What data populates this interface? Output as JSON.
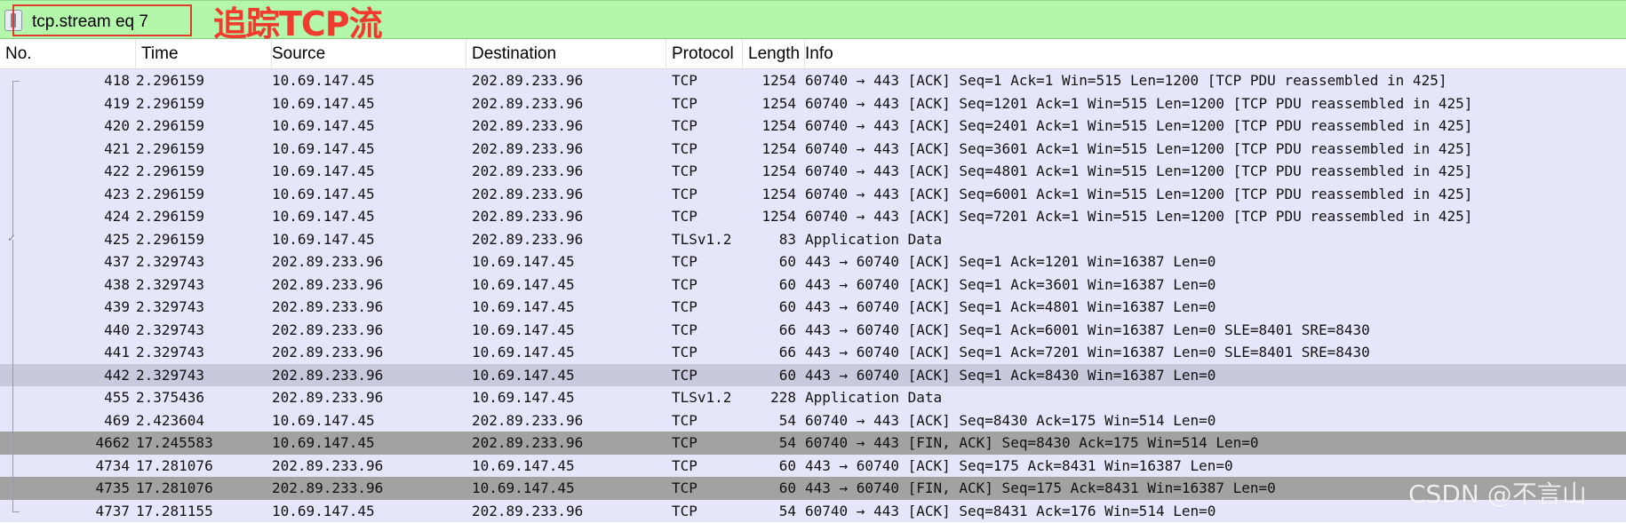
{
  "filter": {
    "value": "tcp.stream eq 7",
    "annotation": "追踪TCP流"
  },
  "columns": {
    "no": "No.",
    "time": "Time",
    "source": "Source",
    "destination": "Destination",
    "protocol": "Protocol",
    "length": "Length",
    "info": "Info"
  },
  "packets": [
    {
      "no": "418",
      "time": "2.296159",
      "src": "10.69.147.45",
      "dst": "202.89.233.96",
      "proto": "TCP",
      "len": "1254",
      "info": "60740 → 443 [ACK] Seq=1 Ack=1 Win=515 Len=1200 [TCP PDU reassembled in 425]",
      "style": "normal"
    },
    {
      "no": "419",
      "time": "2.296159",
      "src": "10.69.147.45",
      "dst": "202.89.233.96",
      "proto": "TCP",
      "len": "1254",
      "info": "60740 → 443 [ACK] Seq=1201 Ack=1 Win=515 Len=1200 [TCP PDU reassembled in 425]",
      "style": "normal"
    },
    {
      "no": "420",
      "time": "2.296159",
      "src": "10.69.147.45",
      "dst": "202.89.233.96",
      "proto": "TCP",
      "len": "1254",
      "info": "60740 → 443 [ACK] Seq=2401 Ack=1 Win=515 Len=1200 [TCP PDU reassembled in 425]",
      "style": "normal"
    },
    {
      "no": "421",
      "time": "2.296159",
      "src": "10.69.147.45",
      "dst": "202.89.233.96",
      "proto": "TCP",
      "len": "1254",
      "info": "60740 → 443 [ACK] Seq=3601 Ack=1 Win=515 Len=1200 [TCP PDU reassembled in 425]",
      "style": "normal"
    },
    {
      "no": "422",
      "time": "2.296159",
      "src": "10.69.147.45",
      "dst": "202.89.233.96",
      "proto": "TCP",
      "len": "1254",
      "info": "60740 → 443 [ACK] Seq=4801 Ack=1 Win=515 Len=1200 [TCP PDU reassembled in 425]",
      "style": "normal"
    },
    {
      "no": "423",
      "time": "2.296159",
      "src": "10.69.147.45",
      "dst": "202.89.233.96",
      "proto": "TCP",
      "len": "1254",
      "info": "60740 → 443 [ACK] Seq=6001 Ack=1 Win=515 Len=1200 [TCP PDU reassembled in 425]",
      "style": "normal"
    },
    {
      "no": "424",
      "time": "2.296159",
      "src": "10.69.147.45",
      "dst": "202.89.233.96",
      "proto": "TCP",
      "len": "1254",
      "info": "60740 → 443 [ACK] Seq=7201 Ack=1 Win=515 Len=1200 [TCP PDU reassembled in 425]",
      "style": "normal"
    },
    {
      "no": "425",
      "time": "2.296159",
      "src": "10.69.147.45",
      "dst": "202.89.233.96",
      "proto": "TLSv1.2",
      "len": "83",
      "info": "Application Data",
      "style": "normal"
    },
    {
      "no": "437",
      "time": "2.329743",
      "src": "202.89.233.96",
      "dst": "10.69.147.45",
      "proto": "TCP",
      "len": "60",
      "info": "443 → 60740 [ACK] Seq=1 Ack=1201 Win=16387 Len=0",
      "style": "normal"
    },
    {
      "no": "438",
      "time": "2.329743",
      "src": "202.89.233.96",
      "dst": "10.69.147.45",
      "proto": "TCP",
      "len": "60",
      "info": "443 → 60740 [ACK] Seq=1 Ack=3601 Win=16387 Len=0",
      "style": "normal"
    },
    {
      "no": "439",
      "time": "2.329743",
      "src": "202.89.233.96",
      "dst": "10.69.147.45",
      "proto": "TCP",
      "len": "60",
      "info": "443 → 60740 [ACK] Seq=1 Ack=4801 Win=16387 Len=0",
      "style": "normal"
    },
    {
      "no": "440",
      "time": "2.329743",
      "src": "202.89.233.96",
      "dst": "10.69.147.45",
      "proto": "TCP",
      "len": "66",
      "info": "443 → 60740 [ACK] Seq=1 Ack=6001 Win=16387 Len=0 SLE=8401 SRE=8430",
      "style": "normal"
    },
    {
      "no": "441",
      "time": "2.329743",
      "src": "202.89.233.96",
      "dst": "10.69.147.45",
      "proto": "TCP",
      "len": "66",
      "info": "443 → 60740 [ACK] Seq=1 Ack=7201 Win=16387 Len=0 SLE=8401 SRE=8430",
      "style": "normal"
    },
    {
      "no": "442",
      "time": "2.329743",
      "src": "202.89.233.96",
      "dst": "10.69.147.45",
      "proto": "TCP",
      "len": "60",
      "info": "443 → 60740 [ACK] Seq=1 Ack=8430 Win=16387 Len=0",
      "style": "selected"
    },
    {
      "no": "455",
      "time": "2.375436",
      "src": "202.89.233.96",
      "dst": "10.69.147.45",
      "proto": "TLSv1.2",
      "len": "228",
      "info": "Application Data",
      "style": "normal"
    },
    {
      "no": "469",
      "time": "2.423604",
      "src": "10.69.147.45",
      "dst": "202.89.233.96",
      "proto": "TCP",
      "len": "54",
      "info": "60740 → 443 [ACK] Seq=8430 Ack=175 Win=514 Len=0",
      "style": "normal"
    },
    {
      "no": "4662",
      "time": "17.245583",
      "src": "10.69.147.45",
      "dst": "202.89.233.96",
      "proto": "TCP",
      "len": "54",
      "info": "60740 → 443 [FIN, ACK] Seq=8430 Ack=175 Win=514 Len=0",
      "style": "dark"
    },
    {
      "no": "4734",
      "time": "17.281076",
      "src": "202.89.233.96",
      "dst": "10.69.147.45",
      "proto": "TCP",
      "len": "60",
      "info": "443 → 60740 [ACK] Seq=175 Ack=8431 Win=16387 Len=0",
      "style": "normal"
    },
    {
      "no": "4735",
      "time": "17.281076",
      "src": "202.89.233.96",
      "dst": "10.69.147.45",
      "proto": "TCP",
      "len": "60",
      "info": "443 → 60740 [FIN, ACK] Seq=175 Ack=8431 Win=16387 Len=0",
      "style": "dark"
    },
    {
      "no": "4737",
      "time": "17.281155",
      "src": "10.69.147.45",
      "dst": "202.89.233.96",
      "proto": "TCP",
      "len": "54",
      "info": "60740 → 443 [ACK] Seq=8431 Ack=176 Win=514 Len=0",
      "style": "normal"
    }
  ],
  "watermark": "CSDN @不言山",
  "colors": {
    "filter_bg": "#b3f7ab",
    "row_bg": "#e6e6fa",
    "selected_bg": "#c9c9de",
    "fin_bg": "#a2a2a2",
    "annotation": "#f23a2e"
  }
}
